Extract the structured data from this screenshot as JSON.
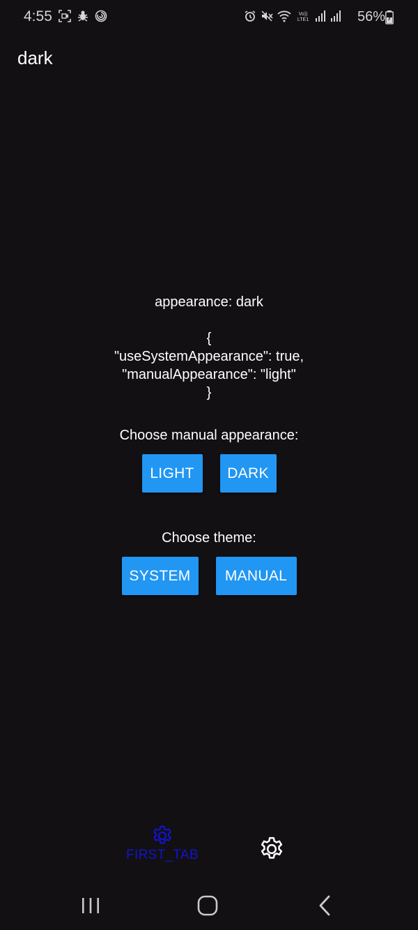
{
  "status_bar": {
    "time": "4:55",
    "battery_percent": "56%",
    "left_icons": [
      "screen-record-icon",
      "bug-icon",
      "spiral-app-icon"
    ],
    "right_icons": [
      "alarm-icon",
      "mute-icon",
      "wifi-icon",
      "volte-icon",
      "signal-icon",
      "signal-icon-2",
      "battery-icon"
    ],
    "volte_label_top": "Vo))",
    "volte_label_bottom": "LTE1"
  },
  "header": {
    "title": "dark"
  },
  "main": {
    "appearance_line": "appearance: dark",
    "json_lines": [
      "{",
      "\"useSystemAppearance\": true,",
      "\"manualAppearance\": \"light\"",
      "}"
    ],
    "choose_appearance_label": "Choose manual appearance:",
    "light_button": "LIGHT",
    "dark_button": "DARK",
    "choose_theme_label": "Choose theme:",
    "system_button": "SYSTEM",
    "manual_button": "MANUAL"
  },
  "tab_bar": {
    "first_tab_label": "FIRST_TAB",
    "first_tab_icon": "gear-icon",
    "second_tab_icon": "gear-icon",
    "active_color": "#1313c9"
  },
  "nav_bar": {
    "icons": [
      "recents-icon",
      "home-icon",
      "back-icon"
    ]
  },
  "colors": {
    "background": "#121013",
    "button": "#2196f3",
    "text": "#ffffff"
  }
}
